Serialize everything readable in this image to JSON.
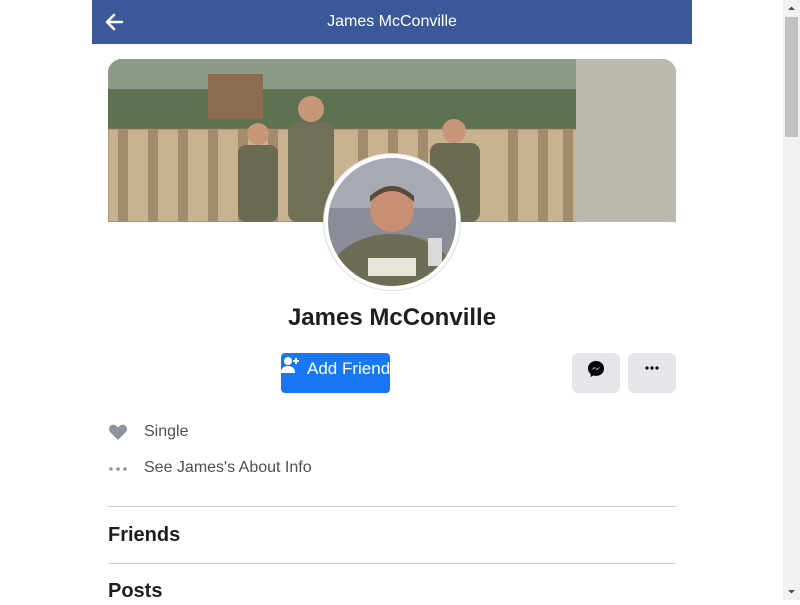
{
  "header": {
    "title": "James McConville",
    "back_icon": "arrow-left-icon",
    "background": "#3b5998"
  },
  "profile": {
    "name": "James McConville"
  },
  "actions": {
    "add_friend_label": "Add Friend",
    "add_friend_icon": "add-person-icon",
    "messenger_icon": "messenger-icon",
    "more_icon": "more-options-icon",
    "accent": "#1877f2"
  },
  "info": [
    {
      "icon": "heart-icon",
      "text": "Single"
    },
    {
      "icon": "more-dots-icon",
      "text": "See James's About Info"
    }
  ],
  "sections": {
    "friends": "Friends",
    "posts": "Posts"
  }
}
